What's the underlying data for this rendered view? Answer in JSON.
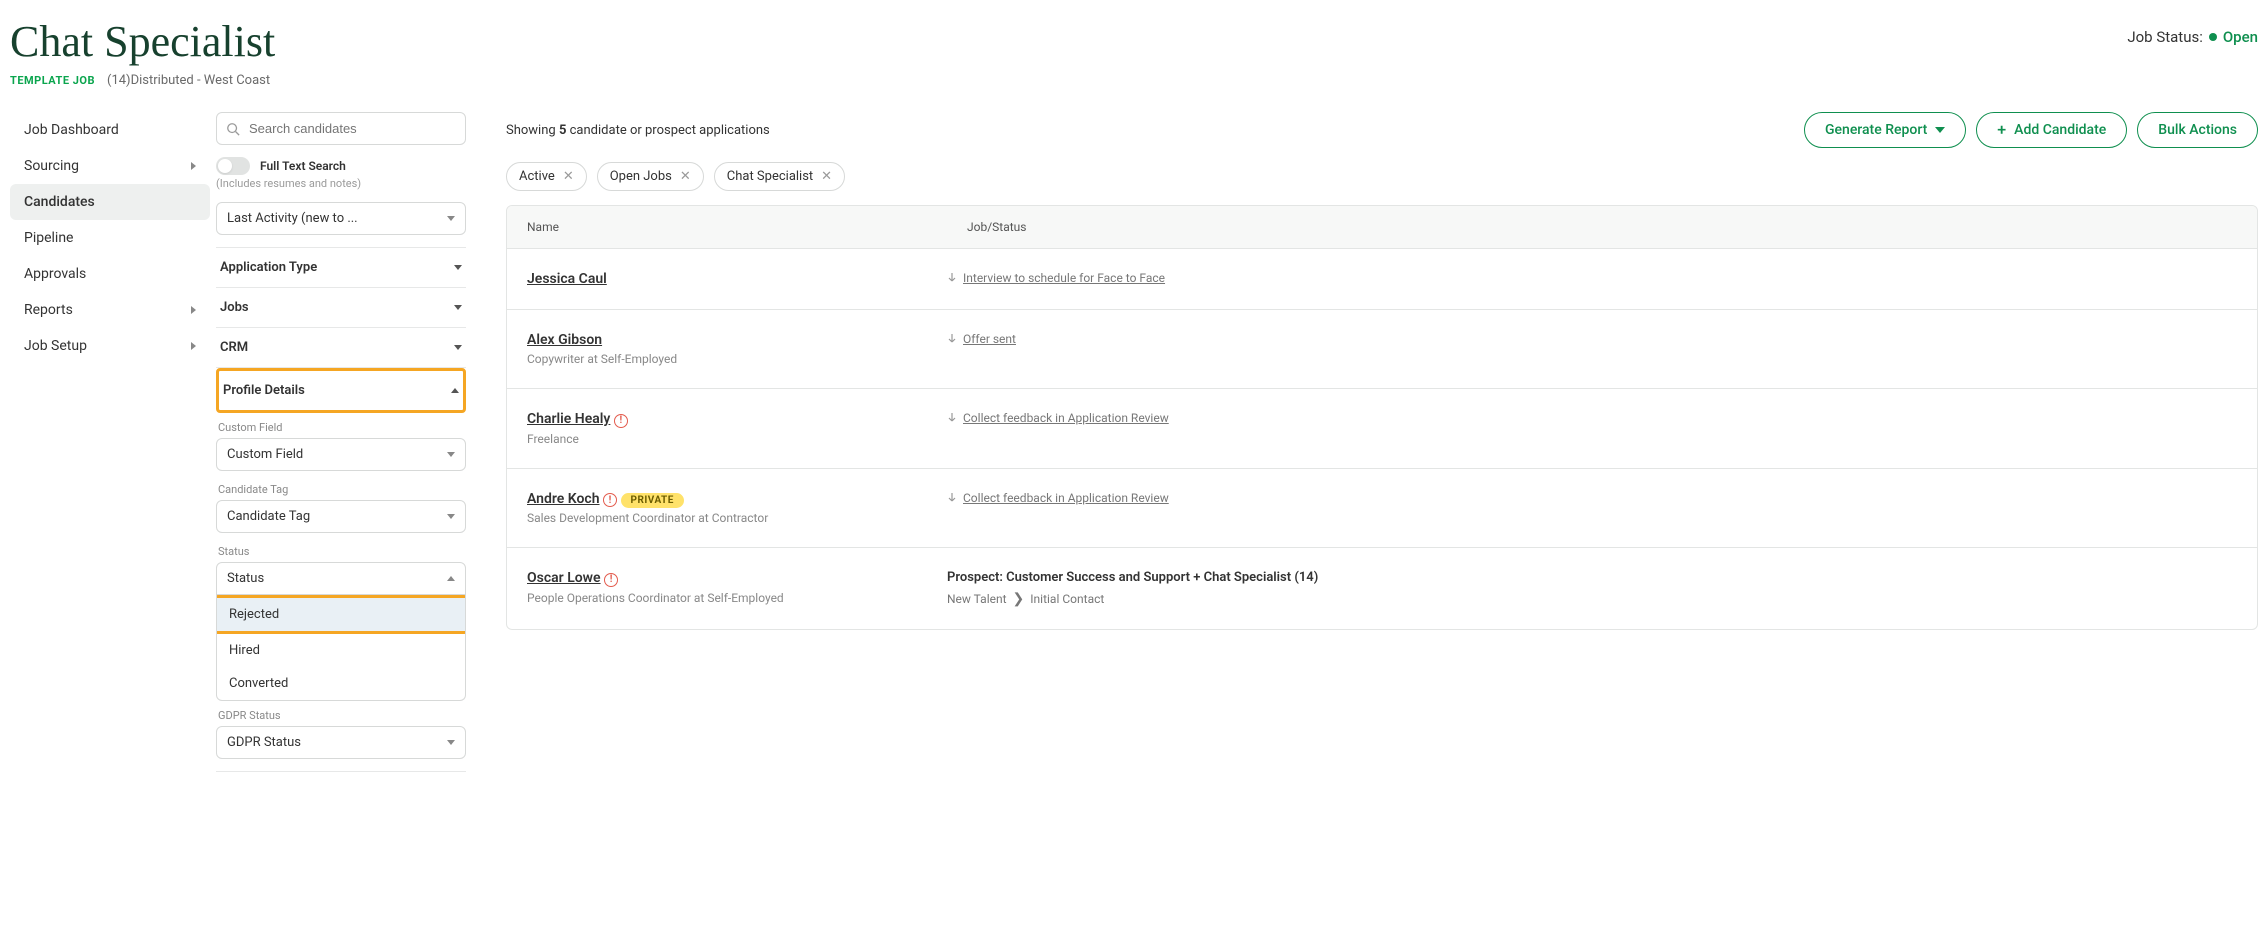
{
  "header": {
    "title": "Chat Specialist",
    "template_badge": "TEMPLATE JOB",
    "meta_count": "(14)",
    "meta_location": "Distributed - West Coast",
    "status_label": "Job Status:",
    "status_value": "Open"
  },
  "nav": {
    "items": [
      {
        "label": "Job Dashboard",
        "has_chevron": false
      },
      {
        "label": "Sourcing",
        "has_chevron": true
      },
      {
        "label": "Candidates",
        "has_chevron": false,
        "active": true
      },
      {
        "label": "Pipeline",
        "has_chevron": false
      },
      {
        "label": "Approvals",
        "has_chevron": false
      },
      {
        "label": "Reports",
        "has_chevron": true
      },
      {
        "label": "Job Setup",
        "has_chevron": true
      }
    ]
  },
  "filters": {
    "search_placeholder": "Search candidates",
    "full_text_label": "Full Text Search",
    "full_text_help": "(Includes resumes and notes)",
    "sort_label": "Last Activity (new to ...",
    "accordion": [
      {
        "label": "Application Type",
        "open": false
      },
      {
        "label": "Jobs",
        "open": false
      },
      {
        "label": "CRM",
        "open": false
      },
      {
        "label": "Profile Details",
        "open": true,
        "highlighted": true
      }
    ],
    "profile_details": {
      "custom_field_label": "Custom Field",
      "custom_field_select": "Custom Field",
      "candidate_tag_label": "Candidate Tag",
      "candidate_tag_select": "Candidate Tag",
      "status_label": "Status",
      "status_select": "Status",
      "status_options": [
        {
          "label": "Rejected",
          "highlighted": true
        },
        {
          "label": "Hired"
        },
        {
          "label": "Converted"
        }
      ],
      "gdpr_label": "GDPR Status",
      "gdpr_select": "GDPR Status"
    }
  },
  "main": {
    "showing_prefix": "Showing ",
    "showing_count": "5",
    "showing_suffix": " candidate or prospect applications",
    "actions": {
      "generate_report": "Generate Report",
      "add_candidate": "Add Candidate",
      "bulk_actions": "Bulk Actions"
    },
    "chips": [
      {
        "label": "Active"
      },
      {
        "label": "Open Jobs"
      },
      {
        "label": "Chat Specialist"
      }
    ],
    "columns": {
      "name": "Name",
      "job": "Job/Status"
    },
    "rows": [
      {
        "name": "Jessica Caul",
        "subtitle": "",
        "alert": false,
        "private": false,
        "status_type": "link",
        "status_text": "Interview to schedule for Face to Face"
      },
      {
        "name": "Alex Gibson",
        "subtitle": "Copywriter at Self-Employed",
        "alert": false,
        "private": false,
        "status_type": "link",
        "status_text": "Offer sent"
      },
      {
        "name": "Charlie Healy",
        "subtitle": "Freelance",
        "alert": true,
        "private": false,
        "status_type": "link",
        "status_text": "Collect feedback in Application Review"
      },
      {
        "name": "Andre Koch",
        "subtitle": "Sales Development Coordinator at Contractor",
        "alert": true,
        "private": true,
        "private_label": "PRIVATE",
        "status_type": "link",
        "status_text": "Collect feedback in Application Review"
      },
      {
        "name": "Oscar Lowe",
        "subtitle": "People Operations Coordinator at Self-Employed",
        "alert": true,
        "private": false,
        "status_type": "prospect",
        "prospect_title": "Prospect: Customer Success and Support + Chat Specialist (14)",
        "stage_from": "New Talent",
        "stage_to": "Initial Contact"
      }
    ]
  }
}
